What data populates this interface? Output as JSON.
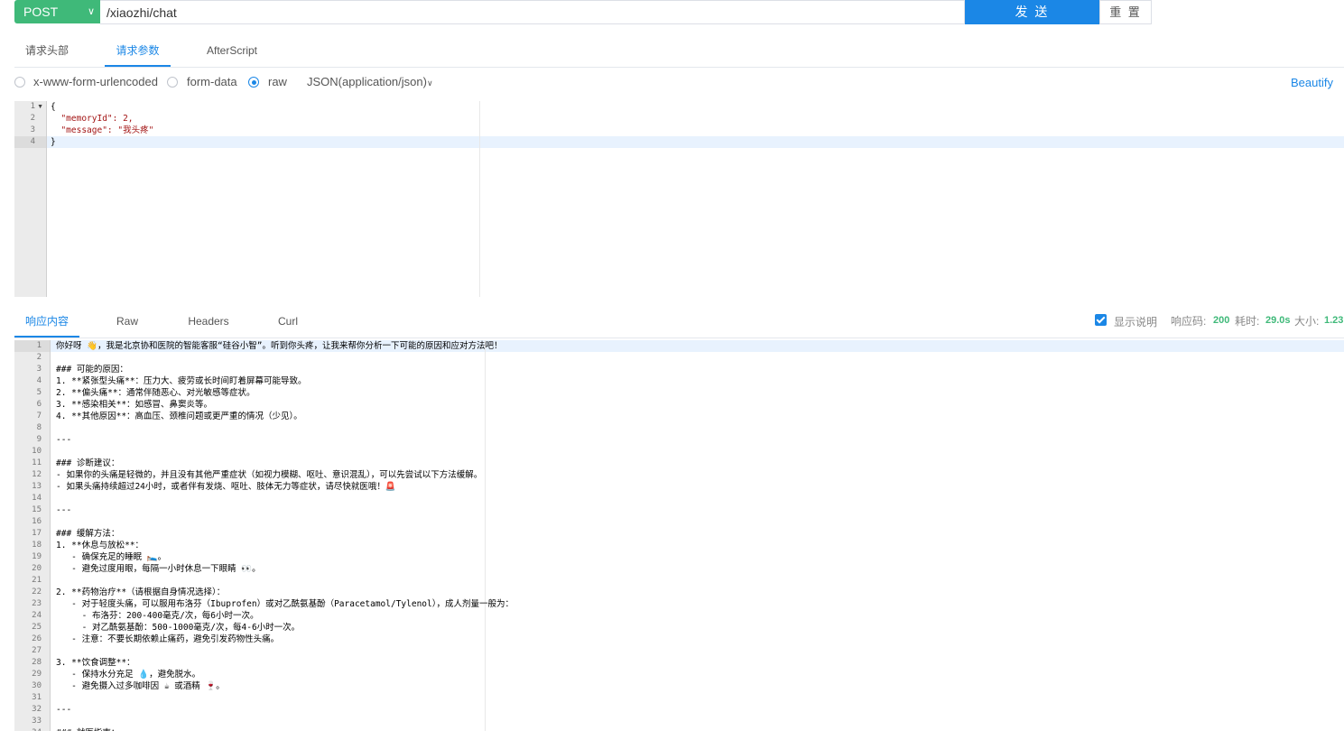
{
  "request": {
    "method": "POST",
    "url": "/xiaozhi/chat",
    "send_label": "发 送",
    "reset_label": "重 置"
  },
  "request_tabs": [
    "请求头部",
    "请求参数",
    "AfterScript"
  ],
  "body_types": {
    "options": [
      "x-www-form-urlencoded",
      "form-data",
      "raw"
    ],
    "selected": "raw",
    "content_type": "JSON(application/json)",
    "beautify_label": "Beautify"
  },
  "request_body": {
    "line_numbers": [
      "1",
      "2",
      "3",
      "4"
    ],
    "lines": [
      "{",
      "  \"memoryId\": 2,",
      "  \"message\": \"我头疼\"",
      "}"
    ]
  },
  "response_tabs": [
    "响应内容",
    "Raw",
    "Headers",
    "Curl"
  ],
  "response_meta": {
    "show_desc_label": "显示说明",
    "status_label": "响应码:",
    "status_value": "200",
    "time_label": "耗时:",
    "time_value": "29.0s",
    "size_label": "大小:",
    "size_value": "1.23"
  },
  "response_body": {
    "lines": [
      "你好呀 👋，我是北京协和医院的智能客服“硅谷小智”。听到你头疼，让我来帮你分析一下可能的原因和应对方法吧！",
      "",
      "### 可能的原因：",
      "1. **紧张型头痛**：压力大、疲劳或长时间盯着屏幕可能导致。",
      "2. **偏头痛**：通常伴随恶心、对光敏感等症状。",
      "3. **感染相关**：如感冒、鼻窦炎等。",
      "4. **其他原因**：高血压、颈椎问题或更严重的情况（少见）。",
      "",
      "---",
      "",
      "### 诊断建议：",
      "- 如果你的头痛是轻微的，并且没有其他严重症状（如视力模糊、呕吐、意识混乱），可以先尝试以下方法缓解。",
      "- 如果头痛持续超过24小时，或者伴有发烧、呕吐、肢体无力等症状，请尽快就医哦！🚨",
      "",
      "---",
      "",
      "### 缓解方法：",
      "1. **休息与放松**：",
      "   - 确保充足的睡眠 🛌。",
      "   - 避免过度用眼，每隔一小时休息一下眼睛 👀。",
      "",
      "2. **药物治疗**（请根据自身情况选择）：",
      "   - 对于轻度头痛，可以服用布洛芬（Ibuprofen）或对乙酰氨基酚（Paracetamol/Tylenol），成人剂量一般为：",
      "     - 布洛芬：200-400毫克/次，每6小时一次。",
      "     - 对乙酰氨基酚：500-1000毫克/次，每4-6小时一次。",
      "   - 注意：不要长期依赖止痛药，避免引发药物性头痛。",
      "",
      "3. **饮食调整**：",
      "   - 保持水分充足 💧，避免脱水。",
      "   - 避免摄入过多咖啡因 ☕ 或酒精 🍷。",
      "",
      "---",
      "",
      "### 就医指南："
    ]
  }
}
